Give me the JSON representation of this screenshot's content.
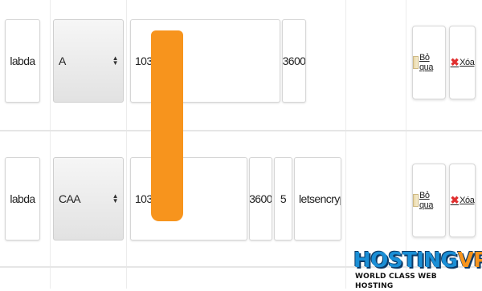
{
  "rows": [
    {
      "name": "labda",
      "type": "A",
      "value": "103.1",
      "ttl": "3600",
      "skip_label": "Bỏ qua",
      "delete_label": "Xóa"
    },
    {
      "name": "labda",
      "type": "CAA",
      "value": "103.1",
      "ttl": "3600",
      "flag": "5",
      "tag_value": "letsencrypt.or",
      "skip_label": "Bỏ qua",
      "delete_label": "Xóa"
    }
  ],
  "logo": {
    "brand_primary": "HOSTING",
    "brand_accent": "VPS",
    "tagline": "WORLD CLASS WEB HOSTING",
    "colors": {
      "primary": "#1a8fd6",
      "accent": "#f7941d",
      "outline": "#0d3a66"
    }
  },
  "redaction_color": "#f7941d",
  "icons": {
    "skip": "document-icon",
    "delete": "red-x-icon"
  }
}
